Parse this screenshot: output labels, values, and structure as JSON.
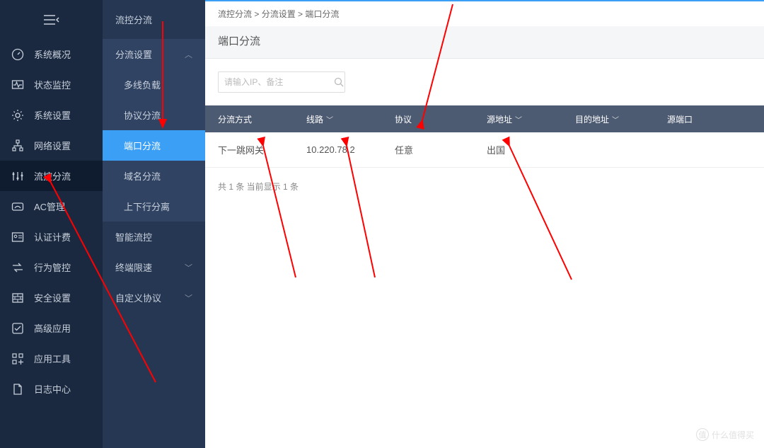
{
  "nav": {
    "items": [
      {
        "label": "系统概况"
      },
      {
        "label": "状态监控"
      },
      {
        "label": "系统设置"
      },
      {
        "label": "网络设置"
      },
      {
        "label": "流控分流"
      },
      {
        "label": "AC管理"
      },
      {
        "label": "认证计费"
      },
      {
        "label": "行为管控"
      },
      {
        "label": "安全设置"
      },
      {
        "label": "高级应用"
      },
      {
        "label": "应用工具"
      },
      {
        "label": "日志中心"
      }
    ]
  },
  "subnav": {
    "title": "流控分流",
    "group_label": "分流设置",
    "items": [
      {
        "label": "多线负载"
      },
      {
        "label": "协议分流"
      },
      {
        "label": "端口分流"
      },
      {
        "label": "域名分流"
      },
      {
        "label": "上下行分离"
      }
    ],
    "extra": [
      {
        "label": "智能流控"
      },
      {
        "label": "终端限速"
      },
      {
        "label": "自定义协议"
      }
    ]
  },
  "breadcrumb": {
    "a": "流控分流",
    "b": "分流设置",
    "c": "端口分流",
    "sep1": " > ",
    "sep2": " > "
  },
  "page_title": "端口分流",
  "search": {
    "placeholder": "请输入IP、备注"
  },
  "table": {
    "headers": {
      "c1": "分流方式",
      "c2": "线路",
      "c3": "协议",
      "c4": "源地址",
      "c5": "目的地址",
      "c6": "源端口"
    },
    "row": {
      "c1": "下一跳网关",
      "c2": "10.220.78.2",
      "c3": "任意",
      "c4": "出国",
      "c5": "",
      "c6": ""
    }
  },
  "summary": "共 1 条 当前显示 1 条",
  "watermark": "什么值得买"
}
